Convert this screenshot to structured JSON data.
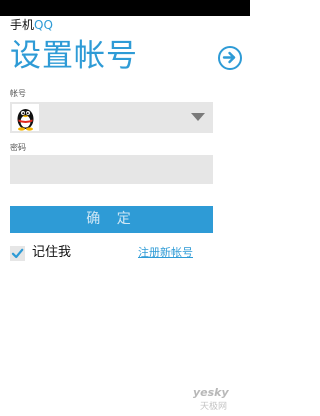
{
  "header": {
    "app_name_part1": "手机",
    "app_name_part2": "QQ",
    "title": "设置帐号"
  },
  "form": {
    "account_label": "帐号",
    "account_value": "",
    "password_label": "密码",
    "password_value": "",
    "confirm_button": "确 定",
    "remember_label": "记住我",
    "remember_checked": true,
    "register_link": "注册新帐号"
  },
  "watermark": {
    "brand": "yesky",
    "subtitle": "天极网"
  },
  "colors": {
    "accent": "#2e9bd6",
    "field_background": "#e6e6e6",
    "status_bar": "#000000"
  },
  "icons": {
    "next": "arrow-right-circle-icon",
    "avatar": "qq-penguin-icon",
    "dropdown": "triangle-down-icon",
    "checkbox": "checkmark-icon"
  }
}
